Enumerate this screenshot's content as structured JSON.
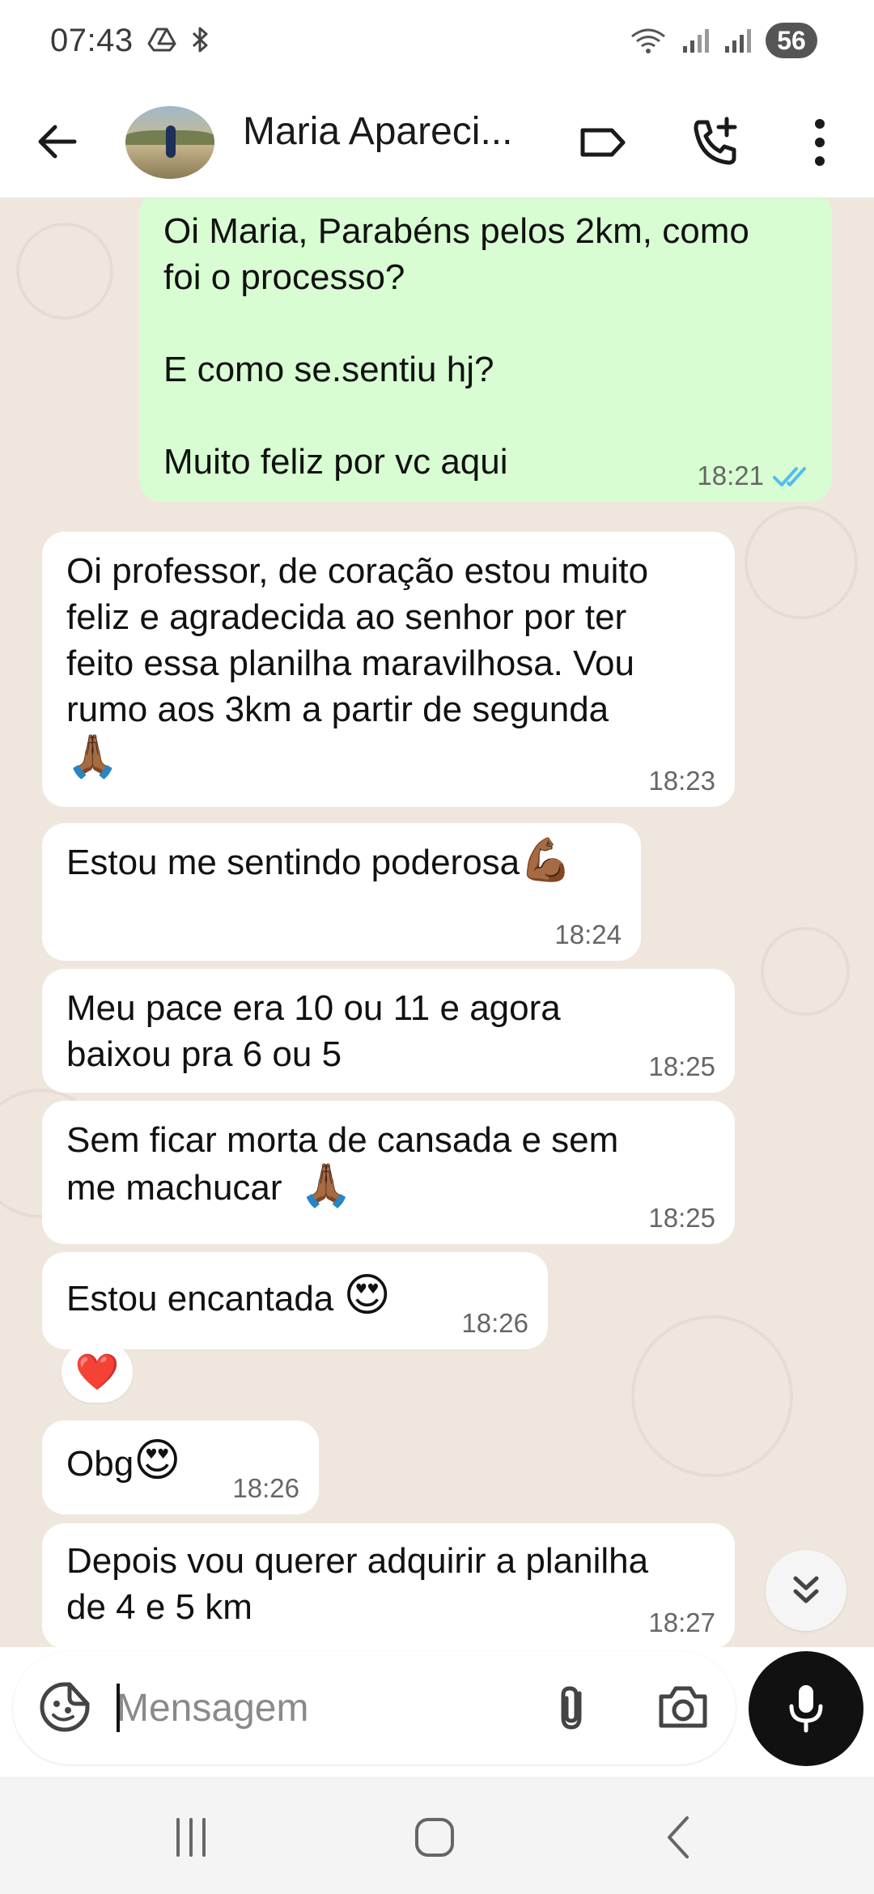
{
  "status_bar": {
    "time": "07:43",
    "battery": "56",
    "icons": [
      "drive-icon",
      "bluetooth-icon",
      "wifi-icon",
      "signal-icon",
      "signal-icon"
    ]
  },
  "header": {
    "contact_name": "Maria Apareci...",
    "icons": [
      "back-arrow-icon",
      "label-icon",
      "add-call-icon",
      "more-vert-icon"
    ]
  },
  "messages": [
    {
      "direction": "out",
      "text": "Oi Maria, Parabéns pelos 2km, como\nfoi o processo?\n\nE como se.sentiu hj?\n\nMuito feliz por vc aqui",
      "time": "18:21",
      "status": "read"
    },
    {
      "direction": "in",
      "text": "Oi professor,  de coração estou muito\nfeliz e agradecida ao senhor por ter\nfeito essa planilha maravilhosa.  Vou\nrumo aos 3km a partir de segunda",
      "emoji": "🙏🏾",
      "time": "18:23"
    },
    {
      "direction": "in",
      "text": "Estou me sentindo poderosa",
      "emoji": "💪🏾",
      "time": "18:24"
    },
    {
      "direction": "in",
      "text": "Meu pace era 10 ou 11 e agora\nbaixou pra 6 ou 5",
      "time": "18:25"
    },
    {
      "direction": "in",
      "text": "Sem ficar morta de cansada e sem\nme machucar",
      "emoji": "🙏🏾",
      "time": "18:25"
    },
    {
      "direction": "in",
      "text": "Estou encantada",
      "emoji": "😍",
      "time": "18:26",
      "reaction": "❤️"
    },
    {
      "direction": "in",
      "text": "Obg",
      "emoji": "😍",
      "time": "18:26"
    },
    {
      "direction": "in",
      "text": "Depois vou querer adquirir a planilha\nde 4 e 5 km",
      "time": "18:27"
    }
  ],
  "composer": {
    "placeholder": "Mensagem",
    "value": "",
    "icons": [
      "sticker-icon",
      "attach-icon",
      "camera-icon",
      "mic-icon"
    ]
  },
  "nav_bar": {
    "icons": [
      "recent-apps-icon",
      "home-icon",
      "back-icon"
    ]
  },
  "colors": {
    "outgoing_bubble": "#d8fdd2",
    "incoming_bubble": "#ffffff",
    "chat_background": "#efe7dd",
    "read_ticks": "#53bdeb",
    "mic_button": "#111111"
  }
}
